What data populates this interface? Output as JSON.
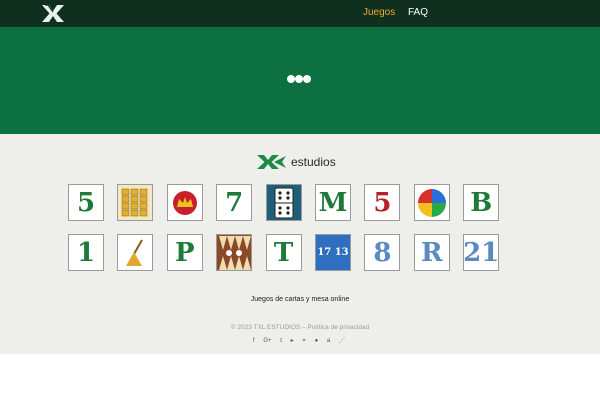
{
  "nav": {
    "logo_icon": "txl-x-logo",
    "links": [
      {
        "label": "Juegos",
        "active": true
      },
      {
        "label": "FAQ",
        "active": false
      }
    ],
    "background": "#0f2f1f",
    "active_color": "#f0a830"
  },
  "hero": {
    "background": "#0c7040",
    "loader_icon": "loading-dots-icon"
  },
  "brand": {
    "logo_icon": "txl-green-logo",
    "name": "estudios"
  },
  "games": [
    {
      "glyph": "5",
      "icon": "cinquillo-card-icon"
    },
    {
      "glyph": "",
      "icon": "card-grid-icon"
    },
    {
      "glyph": "",
      "icon": "crown-card-icon"
    },
    {
      "glyph": "7",
      "icon": "siete-y-media-card-icon"
    },
    {
      "glyph": "",
      "icon": "domino-icon"
    },
    {
      "glyph": "M",
      "icon": "mus-card-icon"
    },
    {
      "glyph": "5",
      "icon": "chinchon-card-icon"
    },
    {
      "glyph": "",
      "icon": "parchis-icon"
    },
    {
      "glyph": "B",
      "icon": "brisca-card-icon"
    },
    {
      "glyph": "1",
      "icon": "tute-card-icon"
    },
    {
      "glyph": "",
      "icon": "escoba-card-icon"
    },
    {
      "glyph": "P",
      "icon": "pocha-card-icon"
    },
    {
      "glyph": "",
      "icon": "backgammon-icon"
    },
    {
      "glyph": "T",
      "icon": "tute-t-card-icon"
    },
    {
      "glyph": "17 13",
      "icon": "bingo-icon"
    },
    {
      "glyph": "8",
      "icon": "crazy-eights-card-icon"
    },
    {
      "glyph": "R",
      "icon": "rummy-card-icon"
    },
    {
      "glyph": "21",
      "icon": "blackjack-card-icon"
    }
  ],
  "footer": {
    "tagline": "Juegos de cartas y mesa online",
    "copyright": "© 2023 TXL ESTUDIOS –",
    "privacy_link": "Política de privacidad",
    "social_icons": [
      {
        "icon": "facebook-icon",
        "glyph": "f"
      },
      {
        "icon": "google-plus-icon",
        "glyph": "G+"
      },
      {
        "icon": "twitter-icon",
        "glyph": "t"
      },
      {
        "icon": "google-play-icon",
        "glyph": "▸"
      },
      {
        "icon": "android-icon",
        "glyph": "◓"
      },
      {
        "icon": "apple-icon",
        "glyph": "●"
      },
      {
        "icon": "amazon-icon",
        "glyph": "a"
      },
      {
        "icon": "rss-icon",
        "glyph": "⋰"
      }
    ]
  }
}
